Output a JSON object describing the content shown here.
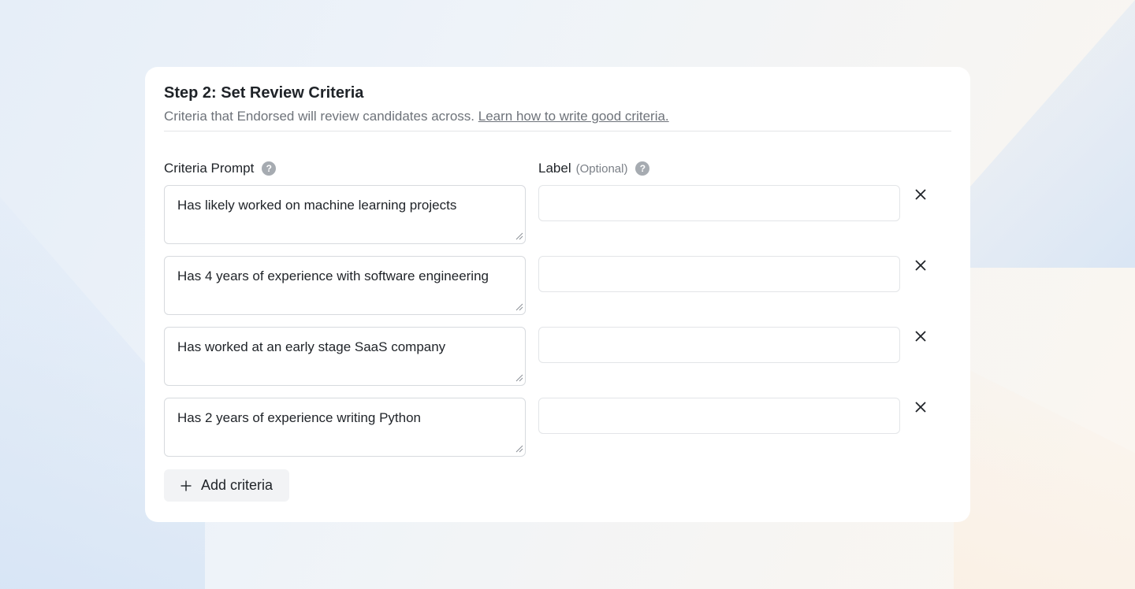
{
  "step": {
    "title": "Step 2: Set Review Criteria",
    "subtitle": "Criteria that Endorsed will review candidates across.",
    "learn_link": "Learn how to write good criteria."
  },
  "columns": {
    "prompt_label": "Criteria Prompt",
    "label_label": "Label",
    "label_optional": "(Optional)",
    "help_glyph": "?"
  },
  "criteria": [
    {
      "prompt": "Has likely worked on machine learning projects",
      "label": ""
    },
    {
      "prompt": "Has 4 years of experience with software engineering",
      "label": ""
    },
    {
      "prompt": "Has worked at an early stage SaaS company",
      "label": ""
    },
    {
      "prompt": "Has 2 years of experience writing Python",
      "label": ""
    }
  ],
  "actions": {
    "add_label": "Add criteria"
  },
  "icons": {
    "help": "help-circle-icon",
    "remove": "close-icon",
    "add": "plus-icon"
  }
}
